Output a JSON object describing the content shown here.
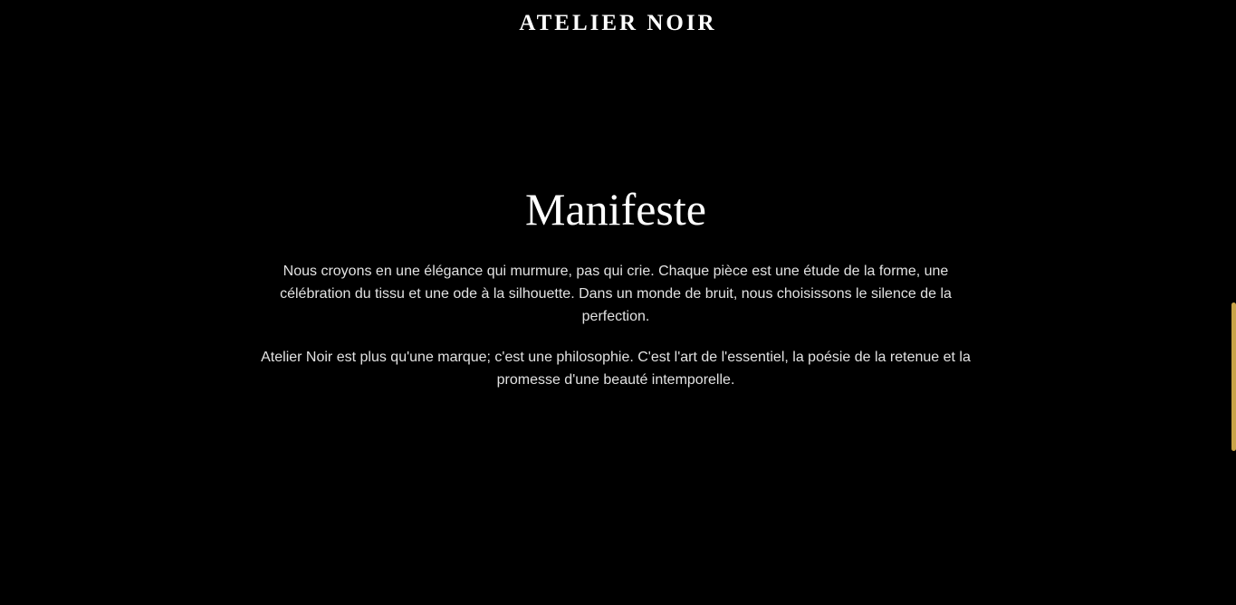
{
  "header": {
    "brand": "ATELIER NOIR"
  },
  "manifesto": {
    "title": "Manifeste",
    "paragraphs": [
      "Nous croyons en une élégance qui murmure, pas qui crie. Chaque pièce est une étude de la forme, une célébration du tissu et une ode à la silhouette. Dans un monde de bruit, nous choisissons le silence de la perfection.",
      "Atelier Noir est plus qu'une marque; c'est une philosophie. C'est l'art de l'essentiel, la poésie de la retenue et la promesse d'une beauté intemporelle."
    ]
  },
  "colors": {
    "background": "#000000",
    "accent": "#c9a449"
  }
}
